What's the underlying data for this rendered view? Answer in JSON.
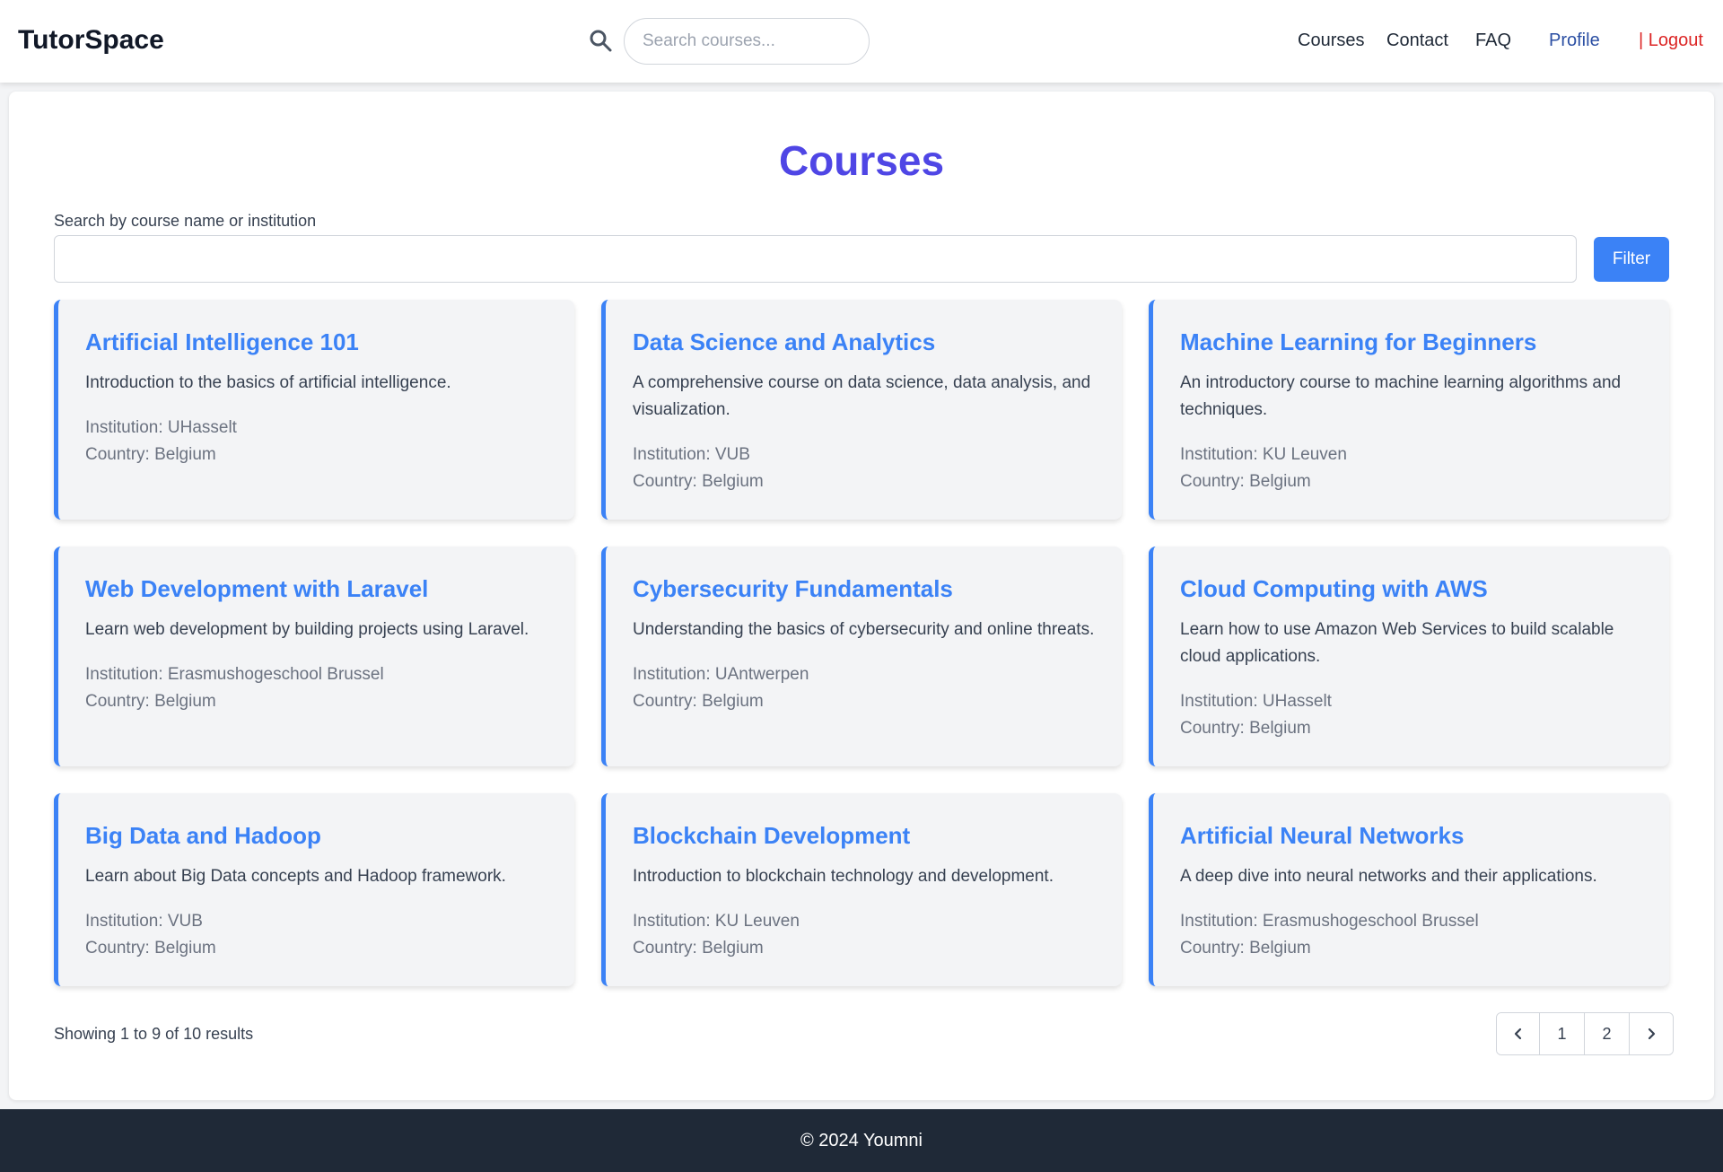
{
  "header": {
    "brand": "TutorSpace",
    "search_placeholder": "Search courses...",
    "nav": {
      "courses": "Courses",
      "contact": "Contact",
      "faq": "FAQ",
      "profile": "Profile",
      "logout": "| Logout"
    }
  },
  "main": {
    "title": "Courses",
    "filter_label": "Search by course name or institution",
    "filter_value": "",
    "filter_button": "Filter",
    "courses": [
      {
        "title": "Artificial Intelligence 101",
        "description": "Introduction to the basics of artificial intelligence.",
        "institution": "Institution: UHasselt",
        "country": "Country: Belgium"
      },
      {
        "title": "Data Science and Analytics",
        "description": "A comprehensive course on data science, data analysis, and visualization.",
        "institution": "Institution: VUB",
        "country": "Country: Belgium"
      },
      {
        "title": "Machine Learning for Beginners",
        "description": "An introductory course to machine learning algorithms and techniques.",
        "institution": "Institution: KU Leuven",
        "country": "Country: Belgium"
      },
      {
        "title": "Web Development with Laravel",
        "description": "Learn web development by building projects using Laravel.",
        "institution": "Institution: Erasmushogeschool Brussel",
        "country": "Country: Belgium"
      },
      {
        "title": "Cybersecurity Fundamentals",
        "description": "Understanding the basics of cybersecurity and online threats.",
        "institution": "Institution: UAntwerpen",
        "country": "Country: Belgium"
      },
      {
        "title": "Cloud Computing with AWS",
        "description": "Learn how to use Amazon Web Services to build scalable cloud applications.",
        "institution": "Institution: UHasselt",
        "country": "Country: Belgium"
      },
      {
        "title": "Big Data and Hadoop",
        "description": "Learn about Big Data concepts and Hadoop framework.",
        "institution": "Institution: VUB",
        "country": "Country: Belgium"
      },
      {
        "title": "Blockchain Development",
        "description": "Introduction to blockchain technology and development.",
        "institution": "Institution: KU Leuven",
        "country": "Country: Belgium"
      },
      {
        "title": "Artificial Neural Networks",
        "description": "A deep dive into neural networks and their applications.",
        "institution": "Institution: Erasmushogeschool Brussel",
        "country": "Country: Belgium"
      }
    ],
    "results_text": "Showing 1 to 9 of 10 results",
    "pagination": {
      "prev_icon": "chevron-left-icon",
      "pages": [
        "1",
        "2"
      ],
      "next_icon": "chevron-right-icon"
    }
  },
  "footer": {
    "text": "© 2024 Youmni"
  },
  "colors": {
    "accent": "#3b82f6",
    "title": "#4f46e5",
    "logout": "#dc2626",
    "footer_bg": "#1f2937"
  }
}
